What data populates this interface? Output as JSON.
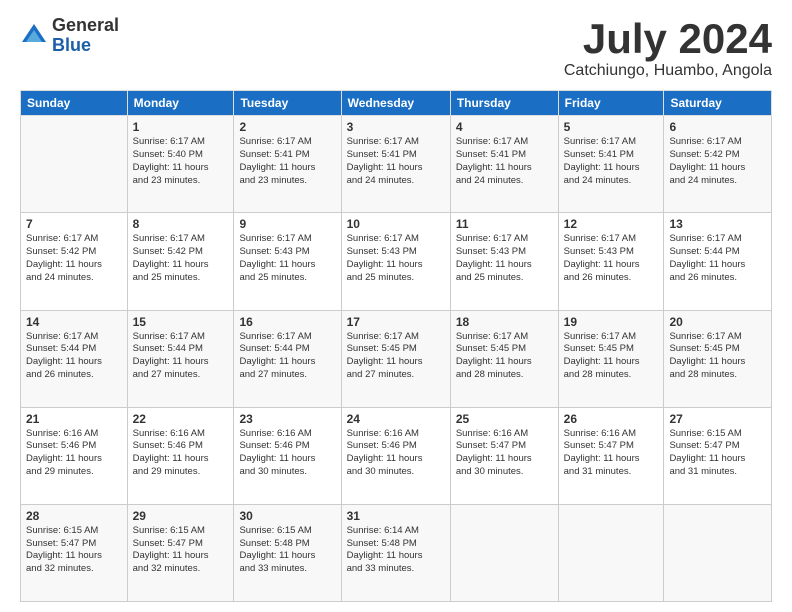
{
  "logo": {
    "general": "General",
    "blue": "Blue"
  },
  "header": {
    "title": "July 2024",
    "subtitle": "Catchiungo, Huambo, Angola"
  },
  "calendar": {
    "days": [
      "Sunday",
      "Monday",
      "Tuesday",
      "Wednesday",
      "Thursday",
      "Friday",
      "Saturday"
    ],
    "weeks": [
      [
        {
          "day": "",
          "content": ""
        },
        {
          "day": "1",
          "content": "Sunrise: 6:17 AM\nSunset: 5:40 PM\nDaylight: 11 hours\nand 23 minutes."
        },
        {
          "day": "2",
          "content": "Sunrise: 6:17 AM\nSunset: 5:41 PM\nDaylight: 11 hours\nand 23 minutes."
        },
        {
          "day": "3",
          "content": "Sunrise: 6:17 AM\nSunset: 5:41 PM\nDaylight: 11 hours\nand 24 minutes."
        },
        {
          "day": "4",
          "content": "Sunrise: 6:17 AM\nSunset: 5:41 PM\nDaylight: 11 hours\nand 24 minutes."
        },
        {
          "day": "5",
          "content": "Sunrise: 6:17 AM\nSunset: 5:41 PM\nDaylight: 11 hours\nand 24 minutes."
        },
        {
          "day": "6",
          "content": "Sunrise: 6:17 AM\nSunset: 5:42 PM\nDaylight: 11 hours\nand 24 minutes."
        }
      ],
      [
        {
          "day": "7",
          "content": "Sunrise: 6:17 AM\nSunset: 5:42 PM\nDaylight: 11 hours\nand 24 minutes."
        },
        {
          "day": "8",
          "content": "Sunrise: 6:17 AM\nSunset: 5:42 PM\nDaylight: 11 hours\nand 25 minutes."
        },
        {
          "day": "9",
          "content": "Sunrise: 6:17 AM\nSunset: 5:43 PM\nDaylight: 11 hours\nand 25 minutes."
        },
        {
          "day": "10",
          "content": "Sunrise: 6:17 AM\nSunset: 5:43 PM\nDaylight: 11 hours\nand 25 minutes."
        },
        {
          "day": "11",
          "content": "Sunrise: 6:17 AM\nSunset: 5:43 PM\nDaylight: 11 hours\nand 25 minutes."
        },
        {
          "day": "12",
          "content": "Sunrise: 6:17 AM\nSunset: 5:43 PM\nDaylight: 11 hours\nand 26 minutes."
        },
        {
          "day": "13",
          "content": "Sunrise: 6:17 AM\nSunset: 5:44 PM\nDaylight: 11 hours\nand 26 minutes."
        }
      ],
      [
        {
          "day": "14",
          "content": "Sunrise: 6:17 AM\nSunset: 5:44 PM\nDaylight: 11 hours\nand 26 minutes."
        },
        {
          "day": "15",
          "content": "Sunrise: 6:17 AM\nSunset: 5:44 PM\nDaylight: 11 hours\nand 27 minutes."
        },
        {
          "day": "16",
          "content": "Sunrise: 6:17 AM\nSunset: 5:44 PM\nDaylight: 11 hours\nand 27 minutes."
        },
        {
          "day": "17",
          "content": "Sunrise: 6:17 AM\nSunset: 5:45 PM\nDaylight: 11 hours\nand 27 minutes."
        },
        {
          "day": "18",
          "content": "Sunrise: 6:17 AM\nSunset: 5:45 PM\nDaylight: 11 hours\nand 28 minutes."
        },
        {
          "day": "19",
          "content": "Sunrise: 6:17 AM\nSunset: 5:45 PM\nDaylight: 11 hours\nand 28 minutes."
        },
        {
          "day": "20",
          "content": "Sunrise: 6:17 AM\nSunset: 5:45 PM\nDaylight: 11 hours\nand 28 minutes."
        }
      ],
      [
        {
          "day": "21",
          "content": "Sunrise: 6:16 AM\nSunset: 5:46 PM\nDaylight: 11 hours\nand 29 minutes."
        },
        {
          "day": "22",
          "content": "Sunrise: 6:16 AM\nSunset: 5:46 PM\nDaylight: 11 hours\nand 29 minutes."
        },
        {
          "day": "23",
          "content": "Sunrise: 6:16 AM\nSunset: 5:46 PM\nDaylight: 11 hours\nand 30 minutes."
        },
        {
          "day": "24",
          "content": "Sunrise: 6:16 AM\nSunset: 5:46 PM\nDaylight: 11 hours\nand 30 minutes."
        },
        {
          "day": "25",
          "content": "Sunrise: 6:16 AM\nSunset: 5:47 PM\nDaylight: 11 hours\nand 30 minutes."
        },
        {
          "day": "26",
          "content": "Sunrise: 6:16 AM\nSunset: 5:47 PM\nDaylight: 11 hours\nand 31 minutes."
        },
        {
          "day": "27",
          "content": "Sunrise: 6:15 AM\nSunset: 5:47 PM\nDaylight: 11 hours\nand 31 minutes."
        }
      ],
      [
        {
          "day": "28",
          "content": "Sunrise: 6:15 AM\nSunset: 5:47 PM\nDaylight: 11 hours\nand 32 minutes."
        },
        {
          "day": "29",
          "content": "Sunrise: 6:15 AM\nSunset: 5:47 PM\nDaylight: 11 hours\nand 32 minutes."
        },
        {
          "day": "30",
          "content": "Sunrise: 6:15 AM\nSunset: 5:48 PM\nDaylight: 11 hours\nand 33 minutes."
        },
        {
          "day": "31",
          "content": "Sunrise: 6:14 AM\nSunset: 5:48 PM\nDaylight: 11 hours\nand 33 minutes."
        },
        {
          "day": "",
          "content": ""
        },
        {
          "day": "",
          "content": ""
        },
        {
          "day": "",
          "content": ""
        }
      ]
    ]
  }
}
